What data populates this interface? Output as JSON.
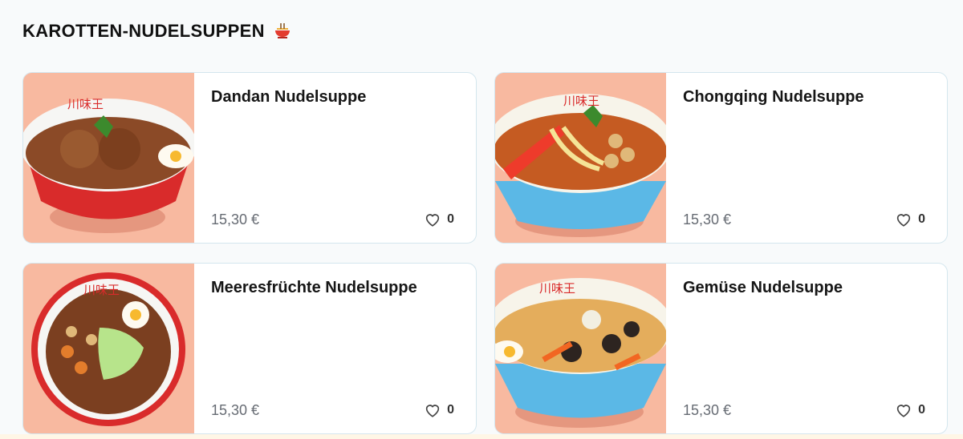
{
  "section": {
    "title": "KAROTTEN-NUDELSUPPEN",
    "title_icon": "noodle-bowl-icon"
  },
  "colors": {
    "image_bg": "#f8b9a0",
    "card_border": "#d4e6ee",
    "price_text": "#666b73",
    "bowl_red": "#d92b2b",
    "bowl_blue": "#5bb8e6"
  },
  "products": [
    {
      "name": "Dandan Nudelsuppe",
      "price": "15,30 €",
      "likes": "0",
      "bowl": "red",
      "icon": "heart-icon"
    },
    {
      "name": "Chongqing Nudelsuppe",
      "price": "15,30 €",
      "likes": "0",
      "bowl": "blue",
      "icon": "heart-icon"
    },
    {
      "name": "Meeresfrüchte Nudelsuppe",
      "price": "15,30 €",
      "likes": "0",
      "bowl": "red-top",
      "icon": "heart-icon"
    },
    {
      "name": "Gemüse Nudelsuppe",
      "price": "15,30 €",
      "likes": "0",
      "bowl": "blue",
      "icon": "heart-icon"
    }
  ]
}
